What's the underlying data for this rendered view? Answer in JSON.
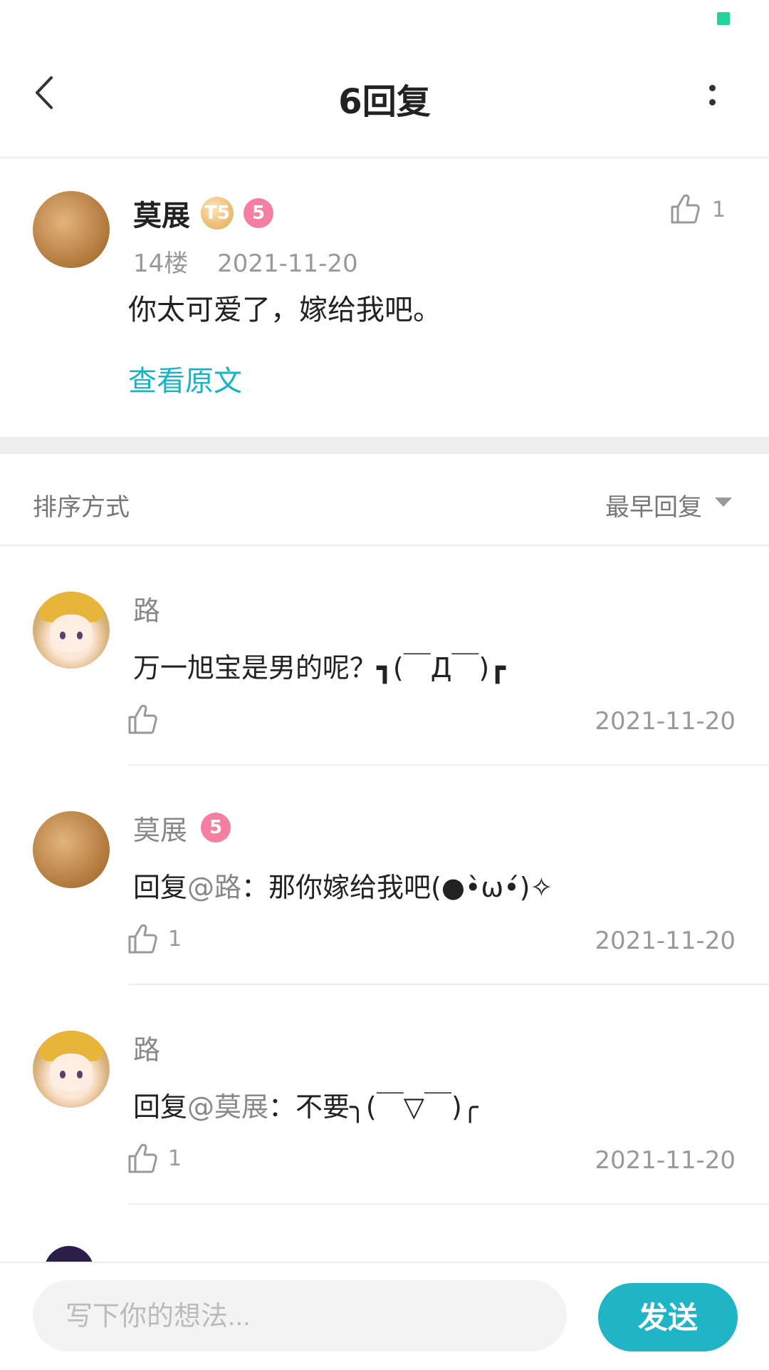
{
  "status": {
    "indicator_color": "#22d39a"
  },
  "header": {
    "title": "6回复",
    "back_icon": "chevron-left-icon",
    "more_icon": "more-vertical-icon"
  },
  "post": {
    "author": "莫展",
    "badges": [
      "T5",
      "5"
    ],
    "floor": "14楼",
    "date": "2021-11-20",
    "content": "你太可爱了，嫁给我吧。",
    "view_original": "查看原文",
    "like_count": "1"
  },
  "sort": {
    "label": "排序方式",
    "value": "最早回复"
  },
  "replies": [
    {
      "author": "路",
      "text": "万一旭宝是男的呢？┓(￣Д￣)┏",
      "mention": "",
      "like_count": "",
      "date": "2021-11-20"
    },
    {
      "author": "莫展",
      "badge": "5",
      "prefix": "回复",
      "mention": "@路",
      "text": "：那你嫁给我吧(●•̀ω•́)✧",
      "like_count": "1",
      "date": "2021-11-20"
    },
    {
      "author": "路",
      "prefix": "回复",
      "mention": "@莫展",
      "text": "：不要╮(￣▽￣)╭",
      "like_count": "1",
      "date": "2021-11-20"
    }
  ],
  "composer": {
    "placeholder": "写下你的想法...",
    "send_label": "发送"
  },
  "colors": {
    "accent": "#1fb4c6",
    "link": "#17b4c5",
    "badge_pink": "#f57fa3"
  }
}
